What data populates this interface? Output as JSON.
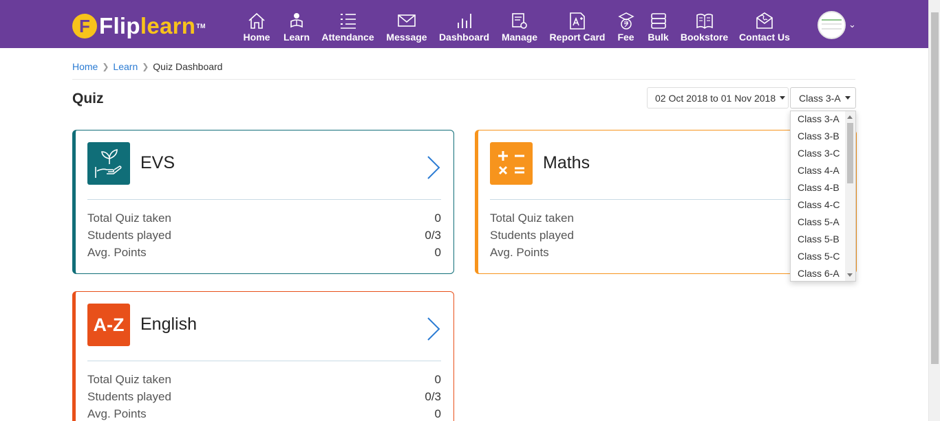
{
  "brand": {
    "flip": "Flip",
    "learn": "learn",
    "tm": "TM",
    "badge": "F"
  },
  "nav": [
    {
      "label": "Home",
      "icon": "home-icon"
    },
    {
      "label": "Learn",
      "icon": "learn-icon"
    },
    {
      "label": "Attendance",
      "icon": "attendance-icon"
    },
    {
      "label": "Message",
      "icon": "message-icon"
    },
    {
      "label": "Dashboard",
      "icon": "dashboard-icon"
    },
    {
      "label": "Manage",
      "icon": "manage-icon"
    },
    {
      "label": "Report Card",
      "icon": "report-card-icon"
    },
    {
      "label": "Fee",
      "icon": "fee-icon"
    },
    {
      "label": "Bulk",
      "icon": "bulk-icon"
    },
    {
      "label": "Bookstore",
      "icon": "bookstore-icon"
    },
    {
      "label": "Contact Us",
      "icon": "contact-icon"
    }
  ],
  "breadcrumb": {
    "home": "Home",
    "learn": "Learn",
    "current": "Quiz Dashboard"
  },
  "page": {
    "title": "Quiz",
    "date_range": "02 Oct 2018 to 01 Nov 2018",
    "selected_class": "Class 3-A"
  },
  "class_options": [
    "Class 3-A",
    "Class 3-B",
    "Class 3-C",
    "Class 4-A",
    "Class 4-B",
    "Class 4-C",
    "Class 5-A",
    "Class 5-B",
    "Class 5-C",
    "Class 6-A"
  ],
  "stat_labels": {
    "total": "Total Quiz taken",
    "students": "Students played",
    "avg": "Avg. Points"
  },
  "subjects": [
    {
      "name": "EVS",
      "icon": "plant-in-hand-icon",
      "color": "#106e78",
      "total": "0",
      "students": "0/3",
      "avg": "0"
    },
    {
      "name": "Maths",
      "icon": "math-operators-icon",
      "color": "#f7941d",
      "total": "",
      "students": "",
      "avg": ""
    },
    {
      "name": "English",
      "icon": "a-z-icon",
      "icon_text": "A-Z",
      "color": "#e8501a",
      "total": "0",
      "students": "0/3",
      "avg": "0"
    }
  ],
  "colors": {
    "topbar": "#6a3d9a",
    "accent_yellow": "#f8c31b",
    "link": "#2a7bd3"
  }
}
